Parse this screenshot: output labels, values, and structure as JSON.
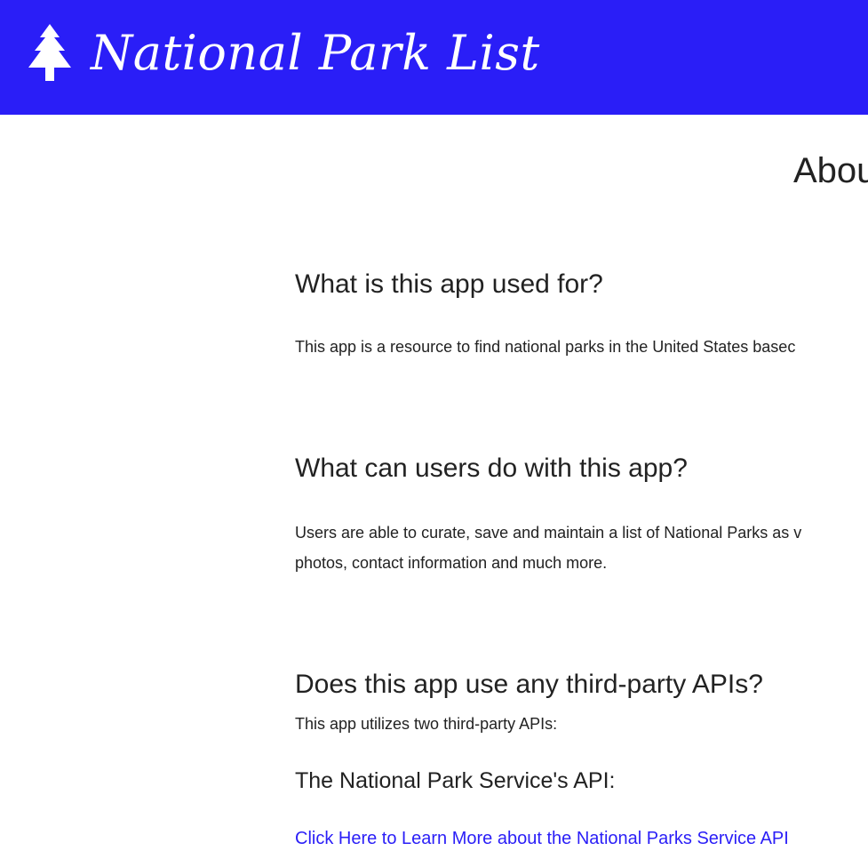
{
  "header": {
    "brand_text": "National Park List",
    "brand_icon": "tree-icon",
    "background_color": "#2a1ef7"
  },
  "page": {
    "title": "Abou"
  },
  "sections": [
    {
      "heading": "What is this app used for?",
      "lines": [
        "This app is a resource to find national parks in the United States basec"
      ]
    },
    {
      "heading": "What can users do with this app?",
      "lines": [
        "Users are able to curate, save and maintain a list of National Parks as v",
        "photos, contact information and much more."
      ]
    },
    {
      "heading": "Does this app use any third-party APIs?",
      "lines": [
        "This app utilizes two third-party APIs:"
      ]
    }
  ],
  "api": {
    "heading": "The National Park Service's API:",
    "link_text": "Click Here to Learn More about the National Parks Service API",
    "link_color": "#2a1ef7"
  }
}
